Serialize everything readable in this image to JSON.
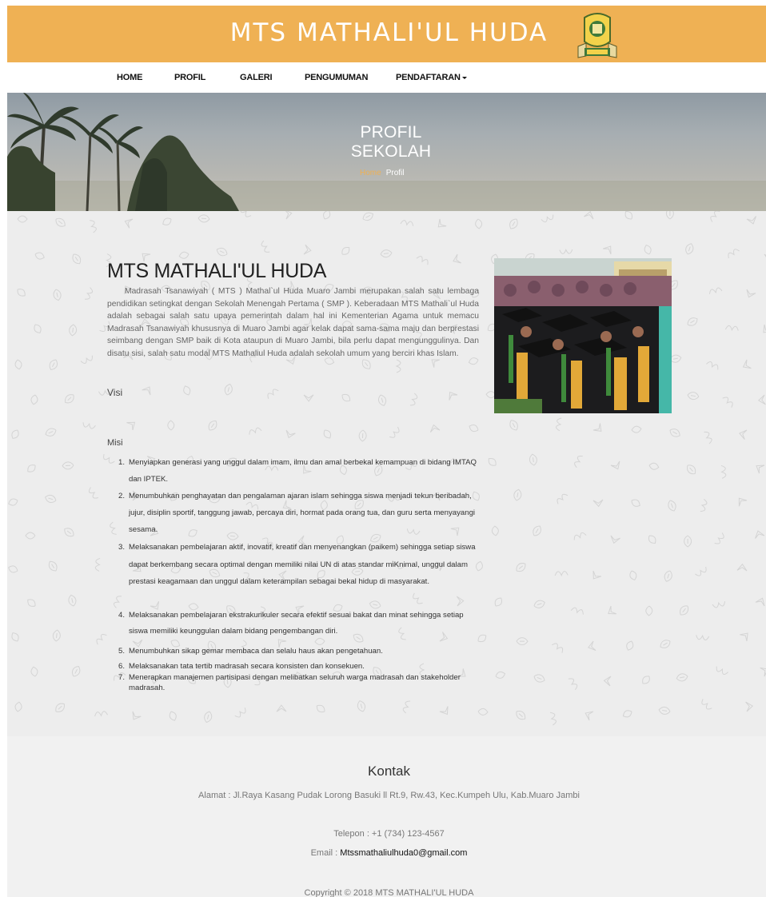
{
  "header": {
    "site_title": "MTS MATHALI'UL HUDA",
    "logo_icon": "school-emblem-icon",
    "brand_color": "#efb154"
  },
  "nav": {
    "items": [
      {
        "label": "HOME"
      },
      {
        "label": "PROFIL"
      },
      {
        "label": "GALERI"
      },
      {
        "label": "PENGUMUMAN"
      },
      {
        "label": "PENDAFTARAN",
        "has_dropdown": true
      }
    ]
  },
  "hero": {
    "title": "PROFIL SEKOLAH",
    "breadcrumb": {
      "home": "Home",
      "current": "Profil"
    }
  },
  "profile": {
    "title": "MTS MATHALI'UL HUDA",
    "intro": "Madrasah Tsanawiyah ( MTS ) Mathal`ul Huda Muaro Jambi merupakan salah satu lembaga pendidikan setingkat dengan Sekolah Menengah Pertama ( SMP ). Keberadaan MTS Mathali`ul Huda adalah sebagai salah satu upaya pemerintah dalam hal ini Kementerian Agama untuk memacu Madrasah Tsanawiyah khususnya di Muaro Jambi agar kelak dapat sama-sama maju dan berprestasi seimbang dengan SMP baik di Kota ataupun di Muaro Jambi, bila perlu dapat mengunggulinya. Dan disatu sisi, salah satu modal MTS Mathaliul Huda adalah sekolah umum yang berciri khas Islam.",
    "visi_label": "Visi",
    "misi_label": "Misi",
    "misi": [
      {
        "num": "1.",
        "text": "Menyiapkan generasi yang unggul dalam imam, ilmu dan amal berbekal kemampuan di bidang IMTAQ dan IPTEK."
      },
      {
        "num": "2.",
        "text": "Menumbuhkan penghayatan dan pengalaman ajaran islam sehingga siswa menjadi tekun beribadah, jujur, disiplin sportif, tanggung jawab, percaya diri, hormat pada orang tua, dan guru serta menyayangi sesama."
      },
      {
        "num": "3.",
        "text": "Melaksanakan pembelajaran aktif, inovatif, kreatif dan menyenangkan (paikem) sehingga setiap siswa dapat berkembang secara optimal dengan memiliki nilai UN di atas standar miKnimal, unggul dalam prestasi keagamaan dan unggul dalam keterampilan sebagai bekal hidup di masyarakat."
      },
      {
        "num": "4.",
        "text": "Melaksanakan pembelajaran ekstrakurikuler secara efektif sesuai bakat dan minat sehingga setiap siswa memiliki keunggulan dalam bidang pengembangan diri."
      },
      {
        "num": "5.",
        "text": "Menumbuhkan sikap gemar membaca dan selalu haus akan pengetahuan."
      },
      {
        "num": "6.",
        "text": "Melaksanakan tata tertib madrasah  secara konsisten dan konsekuen."
      },
      {
        "num": "7.",
        "text": "Menerapkan manajemen partisipasi dengan melibatkan seluruh warga madrasah dan stakeholder madrasah."
      }
    ]
  },
  "footer": {
    "title": "Kontak",
    "address": "Alamat : Jl.Raya Kasang Pudak Lorong Basuki ll Rt.9, Rw.43, Kec.Kumpeh Ulu, Kab.Muaro Jambi",
    "phone": "Telepon : +1 (734) 123-4567",
    "email_label": "Email : ",
    "email": "Mtssmathaliulhuda0@gmail.com",
    "copyright": "Copyright © 2018 MTS MATHALI'UL HUDA"
  }
}
